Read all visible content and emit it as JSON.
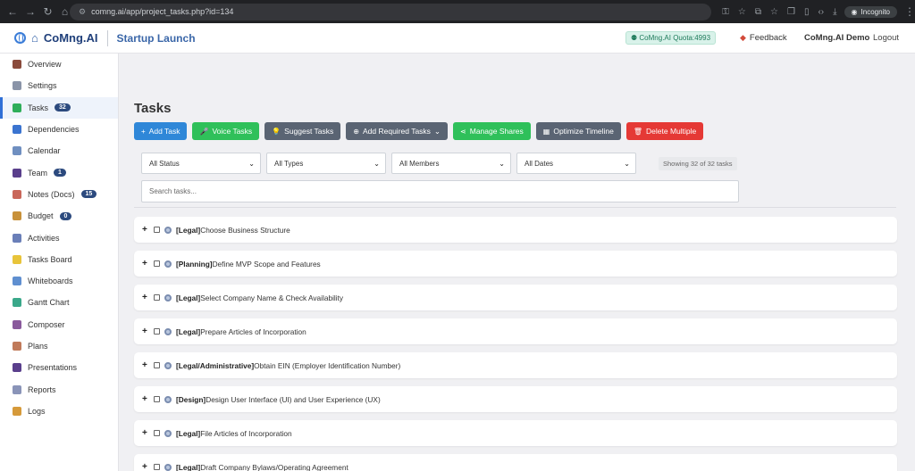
{
  "browser": {
    "url": "comng.ai/app/project_tasks.php?id=134",
    "incognito_label": "Incognito"
  },
  "header": {
    "brand": "CoMng.AI",
    "project": "Startup Launch",
    "quota": "CoMng.AI Quota:4993",
    "feedback": "Feedback",
    "user": "CoMng.AI Demo",
    "logout": "Logout"
  },
  "sidebar": {
    "items": [
      {
        "label": "Overview",
        "icon": "briefcase-icon",
        "color": "#8a4b3c"
      },
      {
        "label": "Settings",
        "icon": "gear-icon",
        "color": "#8a94a8"
      },
      {
        "label": "Tasks",
        "icon": "checkbox-icon",
        "color": "#2fae5a",
        "badge": "32",
        "active": true
      },
      {
        "label": "Dependencies",
        "icon": "link-icon",
        "color": "#3b74d0"
      },
      {
        "label": "Calendar",
        "icon": "calendar-icon",
        "color": "#6f8fc0"
      },
      {
        "label": "Team",
        "icon": "people-icon",
        "color": "#5a3f8c",
        "badge": "1"
      },
      {
        "label": "Notes (Docs)",
        "icon": "notes-icon",
        "color": "#c9675a",
        "badge": "15"
      },
      {
        "label": "Budget",
        "icon": "moneybag-icon",
        "color": "#c8913a",
        "badge": "0"
      },
      {
        "label": "Activities",
        "icon": "chart-icon",
        "color": "#6a7fb8"
      },
      {
        "label": "Tasks Board",
        "icon": "sticky-note-icon",
        "color": "#e8c43a"
      },
      {
        "label": "Whiteboards",
        "icon": "whiteboard-icon",
        "color": "#5f8fd0"
      },
      {
        "label": "Gantt Chart",
        "icon": "gantt-icon",
        "color": "#3aa88a"
      },
      {
        "label": "Composer",
        "icon": "composer-icon",
        "color": "#8a5a9c"
      },
      {
        "label": "Plans",
        "icon": "clipboard-icon",
        "color": "#c07a5a"
      },
      {
        "label": "Presentations",
        "icon": "presentation-icon",
        "color": "#5a3f8c"
      },
      {
        "label": "Reports",
        "icon": "report-icon",
        "color": "#8a94b8"
      },
      {
        "label": "Logs",
        "icon": "scroll-icon",
        "color": "#d69a3a"
      }
    ]
  },
  "main": {
    "title": "Tasks",
    "buttons": [
      {
        "label": "Add Task",
        "icon": "+",
        "color": "blue"
      },
      {
        "label": "Voice Tasks",
        "icon": "🎤",
        "color": "green"
      },
      {
        "label": "Suggest Tasks",
        "icon": "💡",
        "color": "gray"
      },
      {
        "label": "Add Required Tasks",
        "icon": "⊕",
        "color": "gray",
        "dropdown": true
      },
      {
        "label": "Manage Shares",
        "icon": "⋖",
        "color": "green"
      },
      {
        "label": "Optimize Timeline",
        "icon": "▦",
        "color": "gray"
      },
      {
        "label": "Delete Multiple",
        "icon": "🗑",
        "color": "red"
      }
    ],
    "filters": [
      "All Status",
      "All Types",
      "All Members",
      "All Dates"
    ],
    "showing": "Showing 32 of 32 tasks",
    "search_placeholder": "Search tasks...",
    "tasks": [
      {
        "category": "[Legal]",
        "name": "Choose Business Structure"
      },
      {
        "category": "[Planning]",
        "name": "Define MVP Scope and Features"
      },
      {
        "category": "[Legal]",
        "name": "Select Company Name & Check Availability"
      },
      {
        "category": "[Legal]",
        "name": "Prepare Articles of Incorporation"
      },
      {
        "category": "[Legal/Administrative]",
        "name": "Obtain EIN (Employer Identification Number)"
      },
      {
        "category": "[Design]",
        "name": "Design User Interface (UI) and User Experience (UX)"
      },
      {
        "category": "[Legal]",
        "name": "File Articles of Incorporation"
      },
      {
        "category": "[Legal]",
        "name": "Draft Company Bylaws/Operating Agreement"
      }
    ]
  }
}
